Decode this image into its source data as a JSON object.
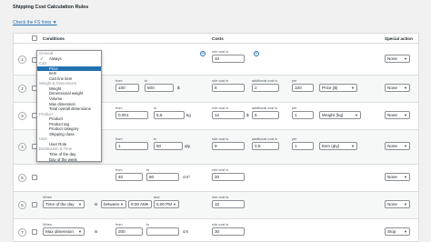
{
  "page": {
    "title": "Shipping Cost Calculation Rules",
    "hints_link": "Check the FS hints ▼"
  },
  "table": {
    "headers": {
      "conditions": "Conditions",
      "costs": "Costs",
      "special": "Special action"
    }
  },
  "dropdown": {
    "items": [
      {
        "kind": "group",
        "label": "General"
      },
      {
        "kind": "option",
        "label": "Always",
        "checked": true
      },
      {
        "kind": "group",
        "label": "Cart"
      },
      {
        "kind": "option",
        "label": "Price",
        "active": true
      },
      {
        "kind": "option",
        "label": "Item"
      },
      {
        "kind": "option",
        "label": "Cart line item"
      },
      {
        "kind": "group",
        "label": "Weight & Dimensions"
      },
      {
        "kind": "option",
        "label": "Weight"
      },
      {
        "kind": "option",
        "label": "Dimensional weight"
      },
      {
        "kind": "option",
        "label": "Volume"
      },
      {
        "kind": "option",
        "label": "Max dimension"
      },
      {
        "kind": "option",
        "label": "Total overall dimensions"
      },
      {
        "kind": "group",
        "label": "Product"
      },
      {
        "kind": "option",
        "label": "Product"
      },
      {
        "kind": "option",
        "label": "Product tag"
      },
      {
        "kind": "option",
        "label": "Product category"
      },
      {
        "kind": "option",
        "label": "Shipping class"
      },
      {
        "kind": "group",
        "label": "User"
      },
      {
        "kind": "option",
        "label": "User Role"
      },
      {
        "kind": "group",
        "label": "Destination & Time"
      },
      {
        "kind": "option",
        "label": "Time of the day"
      },
      {
        "kind": "option",
        "label": "Day of the week"
      }
    ]
  },
  "rows": [
    {
      "num": "1",
      "cost_label": "rule cost is",
      "cost": "10",
      "special": "None"
    },
    {
      "num": "2",
      "from_label": "from",
      "from": "100",
      "to_label": "to",
      "to": "500",
      "unit": "$",
      "cost_label": "rule cost is",
      "cost": "8",
      "add_label": "additional cost is",
      "add": "2",
      "per_label": "per",
      "per": "100",
      "per_select": "Price ($)",
      "special": "None"
    },
    {
      "num": "3",
      "from_label": "from",
      "from": "0,001",
      "to_label": "to",
      "to": "5,5",
      "unit": "kg",
      "cost_label": "rule cost is",
      "cost": "12",
      "currency": "$",
      "add_label": "additional cost is",
      "add": "5",
      "per_label": "per",
      "per": "1",
      "per_select": "Weight (kg)",
      "special": "None"
    },
    {
      "num": "4",
      "from_label": "from",
      "from": "1",
      "to_label": "to",
      "to": "50",
      "unit": "qty",
      "cost_label": "rule cost is",
      "cost": "9",
      "add_label": "additional cost is",
      "add": "0,5",
      "per_label": "per",
      "per": "1",
      "per_select": "Item (qty)",
      "special": "None"
    },
    {
      "num": "5",
      "from_label": "from",
      "from": "40",
      "to_label": "to",
      "to": "60",
      "unit": "cm³",
      "cost_label": "rule cost is",
      "cost": "20",
      "special": "None"
    },
    {
      "num": "6",
      "when_label": "When",
      "cond": "Time of the day",
      "op_label": "is",
      "op": "between",
      "from": "9:00 AM",
      "and_label": "and",
      "to": "5:00 PM",
      "cost_label": "rule cost is",
      "cost": "15",
      "special": "None"
    },
    {
      "num": "7",
      "when_label": "When",
      "cond": "Max dimension",
      "op_label": "is",
      "from_label": "from",
      "from": "200",
      "to_label": "to",
      "to": "",
      "unit": "cm",
      "cost_label": "rule cost is",
      "cost": "30",
      "special": "Stop"
    }
  ],
  "colors": {
    "accent": "#2271b1",
    "border": "#dcdcde",
    "background": "#f1f1f1"
  }
}
